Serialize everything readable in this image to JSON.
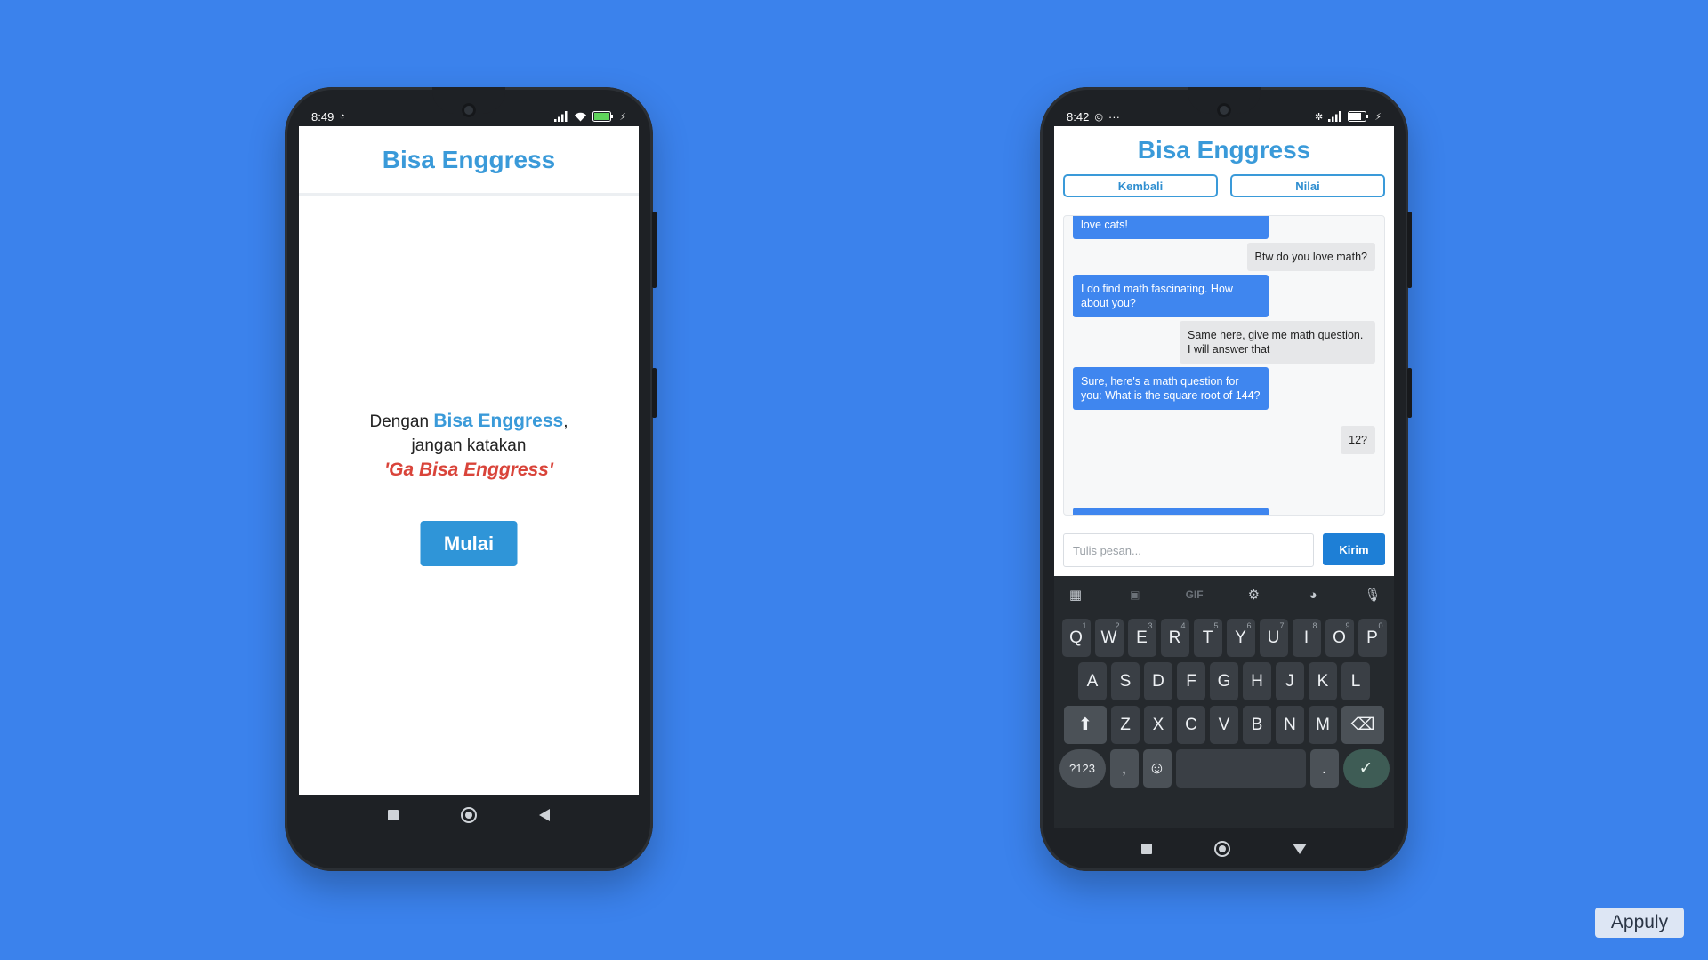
{
  "colors": {
    "background": "#3b82ec",
    "brand": "#3a9ad9",
    "warning": "#d9443a",
    "bot_bubble": "#3f86ef",
    "user_bubble": "#e6e7e9",
    "send_button": "#1e7fd6"
  },
  "left_phone": {
    "status": {
      "time": "8:49"
    },
    "title": "Bisa Enggress",
    "intro": {
      "prefix": "Dengan ",
      "brand": "Bisa Enggress",
      "suffix": ",",
      "line2": "jangan katakan",
      "line3": "'Ga Bisa Enggress'"
    },
    "start_label": "Mulai"
  },
  "right_phone": {
    "status": {
      "time": "8:42",
      "extra": "···"
    },
    "title": "Bisa Enggress",
    "tabs": {
      "back": "Kembali",
      "score": "Nilai"
    },
    "messages": [
      {
        "role": "bot",
        "text": "love cats!"
      },
      {
        "role": "user",
        "text": "Btw do you love math?"
      },
      {
        "role": "bot",
        "text": "I do find math fascinating. How about you?"
      },
      {
        "role": "user",
        "text": "Same here, give me math question. I will answer that"
      },
      {
        "role": "bot",
        "text": "Sure, here's a math question for you: What is the square root of 144?"
      },
      {
        "role": "user",
        "text": "12?"
      }
    ],
    "composer": {
      "placeholder": "Tulis pesan...",
      "send_label": "Kirim"
    },
    "keyboard": {
      "toolbar": [
        "apps-icon",
        "sticker-icon",
        "GIF",
        "gear-icon",
        "palette-icon",
        "mic-icon"
      ],
      "row1": [
        "Q",
        "W",
        "E",
        "R",
        "T",
        "Y",
        "U",
        "I",
        "O",
        "P"
      ],
      "row1_hints": [
        "1",
        "2",
        "3",
        "4",
        "5",
        "6",
        "7",
        "8",
        "9",
        "0"
      ],
      "row2": [
        "A",
        "S",
        "D",
        "F",
        "G",
        "H",
        "J",
        "K",
        "L"
      ],
      "row3": [
        "Z",
        "X",
        "C",
        "V",
        "B",
        "N",
        "M"
      ],
      "symbols_label": "?123",
      "comma": ",",
      "period": "."
    }
  },
  "watermark": "Appuly"
}
